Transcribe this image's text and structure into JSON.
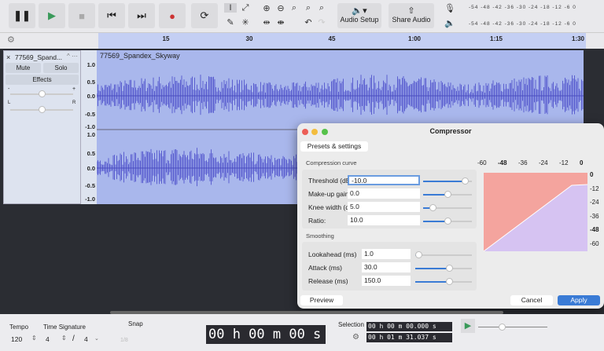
{
  "toolbar": {
    "audio_setup": "Audio Setup",
    "share_audio": "Share Audio",
    "meter_scale": "-54 -48 -42 -36 -30 -24 -18 -12 -6 0",
    "meter_lr_l": "L",
    "meter_lr_r": "R"
  },
  "ruler": {
    "ticks": [
      "15",
      "30",
      "45",
      "1:00",
      "1:15",
      "1:30"
    ]
  },
  "track": {
    "name": "77569_Spand...",
    "clip_name": "77569_Spandex_Skyway",
    "mute": "Mute",
    "solo": "Solo",
    "effects": "Effects",
    "gain_minus": "-",
    "gain_plus": "+",
    "pan_l": "L",
    "pan_r": "R",
    "scale": [
      "1.0",
      "0.5",
      "0.0",
      "-0.5",
      "-1.0"
    ]
  },
  "compressor": {
    "title": "Compressor",
    "presets": "Presets & settings",
    "curve_section": "Compression curve",
    "smoothing_section": "Smoothing",
    "params": [
      {
        "label": "Threshold (dB)",
        "value": "-10.0",
        "slider": 0.85
      },
      {
        "label": "Make-up gain (dB)",
        "value": "0.0",
        "slider": 0.5
      },
      {
        "label": "Knee width (dB)",
        "value": "5.0",
        "slider": 0.2
      },
      {
        "label": "Ratio:",
        "value": "10.0",
        "slider": 0.5
      }
    ],
    "smoothing": [
      {
        "label": "Lookahead (ms)",
        "value": "1.0",
        "slider": 0.05
      },
      {
        "label": "Attack (ms)",
        "value": "30.0",
        "slider": 0.6
      },
      {
        "label": "Release (ms)",
        "value": "150.0",
        "slider": 0.6
      }
    ],
    "x_axis": [
      "-60",
      "-48",
      "-36",
      "-24",
      "-12",
      "0"
    ],
    "y_axis": [
      "0",
      "-12",
      "-24",
      "-36",
      "-48",
      "-60"
    ],
    "preview": "Preview",
    "cancel": "Cancel",
    "apply": "Apply",
    "colors": {
      "above": "#f4a49e",
      "below": "#d6c3f2",
      "accent": "#3a7bd5"
    }
  },
  "bottom": {
    "tempo_label": "Tempo",
    "tempo": "120",
    "timesig_label": "Time Signature",
    "ts_num": "4",
    "ts_sep": "/",
    "ts_den": "4",
    "snap_label": "Snap",
    "snap_value": "1/8",
    "time": "00 h 00 m 00 s",
    "selection_label": "Selection",
    "sel_start": "00 h 00 m 00.000 s",
    "sel_end": "00 h 01 m 31.037 s"
  }
}
